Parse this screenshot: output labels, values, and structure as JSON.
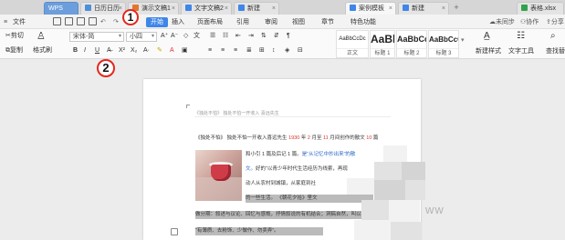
{
  "tabs": [
    {
      "label": "WPS",
      "color": "#6d9edc",
      "active": false
    },
    {
      "label": "日历日历",
      "color": "#4f8fd8",
      "active": false
    },
    {
      "label": "演示文稿1",
      "color": "#e2762f",
      "active": false
    },
    {
      "label": "文字文稿2",
      "color": "#3f86e8",
      "active": false
    },
    {
      "label": "新建",
      "color": "#3f86e8",
      "active": false
    },
    {
      "label": "案例模板",
      "color": "#3f86e8",
      "active": true
    },
    {
      "label": "新建",
      "color": "#3f86e8",
      "active": false
    },
    {
      "label": "表格.xlsx",
      "color": "#31a24c",
      "active": false
    }
  ],
  "menu": {
    "file": "文件",
    "items": [
      "开始",
      "插入",
      "页面布局",
      "引用",
      "审阅",
      "视图",
      "章节",
      "特色功能"
    ],
    "right": [
      "未同步",
      "协作",
      "分享"
    ]
  },
  "ribbon": {
    "cut": "剪切",
    "copy": "复制",
    "format_painter": "格式刷",
    "font_name": "宋体-简",
    "font_size": "小四",
    "styles": [
      {
        "sample": "AaBbCcDc",
        "name": "正文"
      },
      {
        "sample": "AaBl",
        "name": "标题 1"
      },
      {
        "sample": "AaBbCcC",
        "name": "标题 2"
      },
      {
        "sample": "AaBbCcC",
        "name": "标题 3"
      }
    ],
    "new_style": "新建样式",
    "text_tools": "文字工具",
    "find_replace": "查找替换"
  },
  "callouts": [
    "1",
    "2"
  ],
  "document": {
    "header": "《独处不怕》   独处不怕一开收入  喜远先生",
    "lines": [
      {
        "parts": [
          {
            "t": "《独处不怕》 独处不怕一开收入喜远先生 ",
            "c": ""
          },
          {
            "t": "1930",
            "c": "red"
          },
          {
            "t": " 年 ",
            "c": ""
          },
          {
            "t": "2",
            "c": "red"
          },
          {
            "t": " 月至 ",
            "c": ""
          },
          {
            "t": "11",
            "c": "red"
          },
          {
            "t": " 月间创作的散文 ",
            "c": ""
          },
          {
            "t": "10",
            "c": "red"
          },
          {
            "t": " 篇",
            "c": ""
          }
        ]
      },
      {
        "parts": [
          {
            "t": "和小引 1 篇及后记 1 篇。",
            "c": ""
          },
          {
            "t": "是“从记忆中抄出来”的散",
            "c": "blue"
          }
        ]
      },
      {
        "parts": [
          {
            "t": "文。",
            "c": "blue"
          },
          {
            "t": "好的“以青少年时代生活经历为线索，再现",
            "c": ""
          }
        ]
      },
      {
        "parts": [
          {
            "t": "动人从农村到城镇，从家庭到社",
            "c": ""
          }
        ]
      },
      {
        "parts": [
          {
            "t": "活的一些生活。",
            "c": ""
          }
        ]
      },
      {
        "parts": [
          {
            "t": "的一些生活。  《朝花夕拾》",
            "c": ""
          },
          {
            "t": "里文",
            "c": ""
          }
        ]
      },
      {
        "parts": [
          {
            "t": "做分期：叙述与议论、回忆与感慨，抒情叙说的有机结合；洞稿自然，叫以平易",
            "c": ""
          }
        ]
      },
      {
        "parts": [
          {
            "t": "“有薄质、去粉饰、少做作、勿卖弄”。",
            "c": ""
          }
        ]
      }
    ]
  },
  "watermark": "ww"
}
